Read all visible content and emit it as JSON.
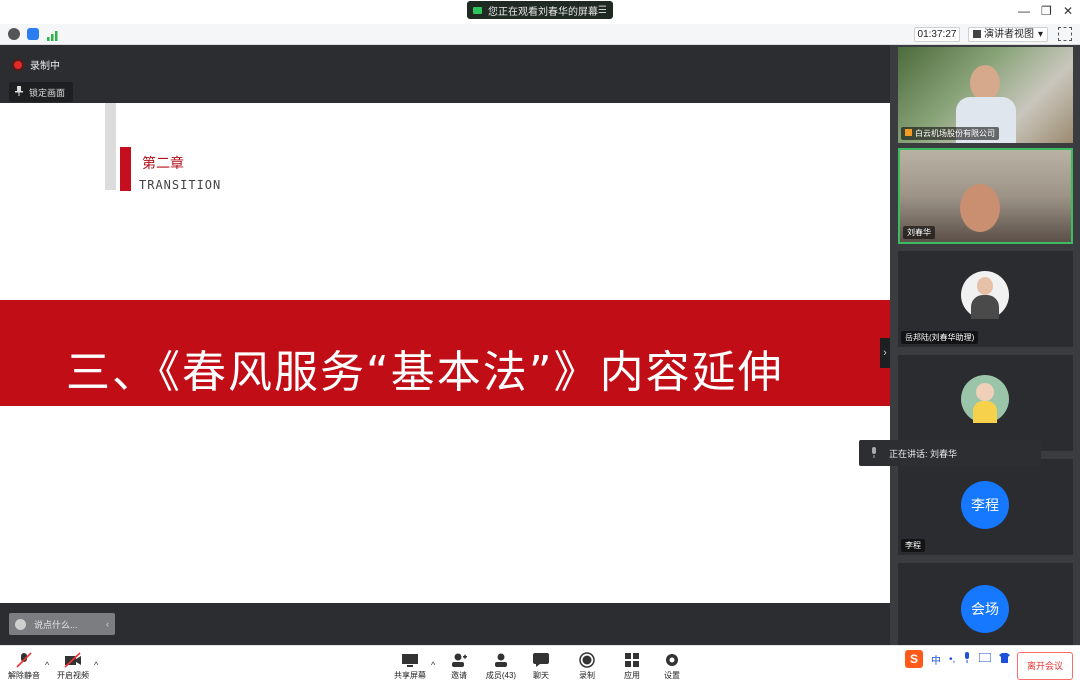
{
  "title_bar": {
    "share_notice": "您正在观看刘春华的屏幕",
    "menu_glyph": "☰",
    "window_buttons": [
      "—",
      "❐",
      "✕"
    ]
  },
  "info_bar": {
    "timer": "01:37:27",
    "view_mode": "演讲者视图",
    "view_mode_caret": "▾"
  },
  "stage": {
    "recording_label": "录制中",
    "lock_screen_label": "锁定画面",
    "chat_placeholder": "说点什么...",
    "chat_collapse": "‹",
    "panel_toggle": "›"
  },
  "slide": {
    "chapter": "第二章",
    "subtitle": "TRANSITION",
    "banner": "三、《春风服务“基本法”》内容延伸"
  },
  "participants": [
    {
      "name": "白云机场股份有限公司"
    },
    {
      "name": "刘春华"
    },
    {
      "name": "岳邦陆(刘春华助理)"
    },
    {
      "name": ""
    },
    {
      "name": "李程",
      "avatar_text": "李程"
    },
    {
      "name": "",
      "avatar_text": "会场"
    }
  ],
  "speaking_now": "正在讲话: 刘春华",
  "bottom_bar": {
    "unmute": "解除静音",
    "start_video": "开启视频",
    "share_screen": "共享屏幕",
    "invite": "邀请",
    "members": "成员(43)",
    "chat": "聊天",
    "record": "录制",
    "apps": "应用",
    "settings": "设置",
    "leave": "离开会议",
    "caret": "^"
  },
  "ime_bar": {
    "logo": "S",
    "mode": "中",
    "punct": "•,"
  },
  "colors": {
    "banner_red": "#c00d16",
    "accent_blue": "#1677ff",
    "speaking_green": "#3dbb61"
  }
}
